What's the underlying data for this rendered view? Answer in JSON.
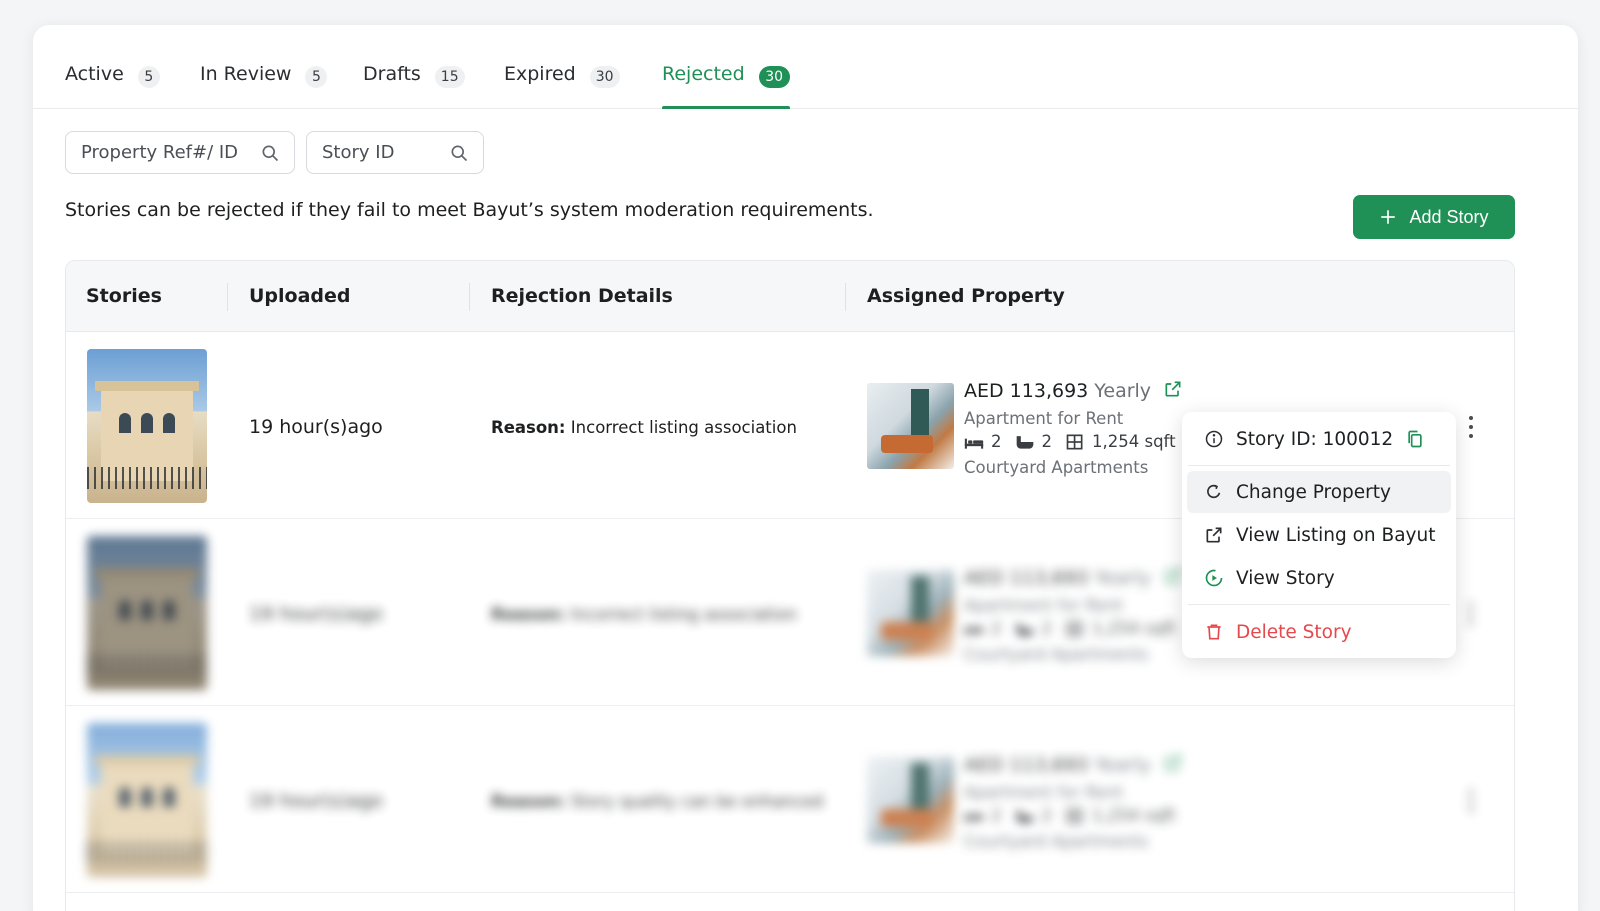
{
  "colors": {
    "accent": "#1f9156",
    "danger": "#e5484d"
  },
  "tabs": [
    {
      "label": "Active",
      "count": "5"
    },
    {
      "label": "In Review",
      "count": "5"
    },
    {
      "label": "Drafts",
      "count": "15"
    },
    {
      "label": "Expired",
      "count": "30"
    },
    {
      "label": "Rejected",
      "count": "30",
      "active": true
    }
  ],
  "filters": {
    "property_placeholder": "Property Ref#/ ID",
    "story_placeholder": "Story ID"
  },
  "note": "Stories can be rejected if they fail to meet Bayut’s system moderation requirements.",
  "add_story_label": "Add Story",
  "table": {
    "headers": [
      "Stories",
      "Uploaded",
      "Rejection Details",
      "Assigned Property"
    ],
    "rows": [
      {
        "uploaded": "19 hour(s)ago",
        "reason_label": "Reason:",
        "reason": "Incorrect listing association",
        "price": "AED 113,693",
        "period": "Yearly",
        "type": "Apartment for Rent",
        "beds": "2",
        "baths": "2",
        "area": "1,254 sqft",
        "name": "Courtyard Apartments"
      },
      {
        "uploaded": "19 hour(s)ago",
        "reason_label": "Reason:",
        "reason": "Incorrect listing association",
        "price": "AED 113,693",
        "period": "Yearly",
        "type": "Apartment for Rent",
        "beds": "2",
        "baths": "2",
        "area": "1,254 sqft",
        "name": "Courtyard Apartments"
      },
      {
        "uploaded": "19 hour(s)ago",
        "reason_label": "Reason:",
        "reason": "Story quality can be enhanced",
        "price": "AED 113,693",
        "period": "Yearly",
        "type": "Apartment for Rent",
        "beds": "2",
        "baths": "2",
        "area": "1,254 sqft",
        "name": "Courtyard Apartments"
      }
    ]
  },
  "menu": {
    "story_id": "Story ID: 100012",
    "change_property": "Change Property",
    "view_listing": "View Listing on Bayut",
    "view_story": "View Story",
    "delete_story": "Delete Story"
  },
  "icons": [
    "search-icon",
    "plus-icon",
    "external-link-icon",
    "bed-icon",
    "bath-icon",
    "area-icon",
    "info-icon",
    "copy-icon",
    "refresh-icon",
    "play-icon",
    "trash-icon",
    "more-vertical-icon"
  ]
}
